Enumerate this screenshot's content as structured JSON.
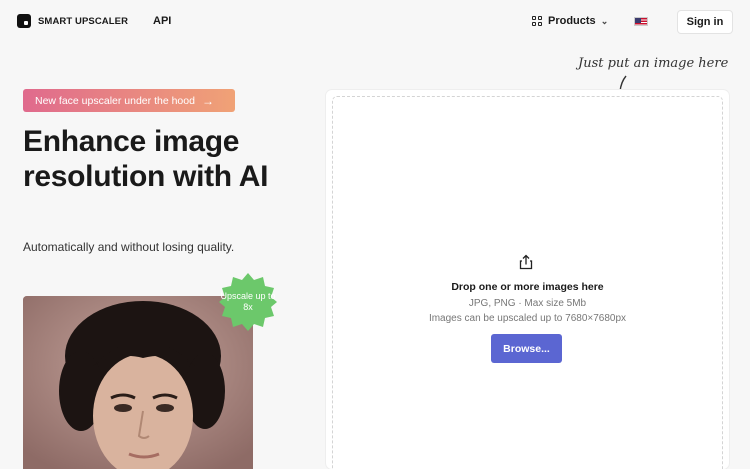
{
  "header": {
    "brand": "SMART UPSCALER",
    "nav_api": "API",
    "products_label": "Products",
    "language_icon": "us-flag-icon",
    "signin_label": "Sign in"
  },
  "hero": {
    "badge_text": "New face upscaler under the hood",
    "headline": "Enhance image resolution with AI",
    "subline": "Automatically and without losing quality.",
    "sticker_text": "Upscale up to 8x"
  },
  "dropzone": {
    "annotation": "Just put an image here",
    "title": "Drop one or more images here",
    "formats": "JPG, PNG · Max size 5Mb",
    "limit": "Images can be upscaled up to 7680×7680px",
    "browse_label": "Browse..."
  },
  "colors": {
    "badge_gradient_start": "#e06a8d",
    "badge_gradient_end": "#f0a276",
    "sticker": "#6cc86b",
    "browse_button": "#5b66d2"
  }
}
